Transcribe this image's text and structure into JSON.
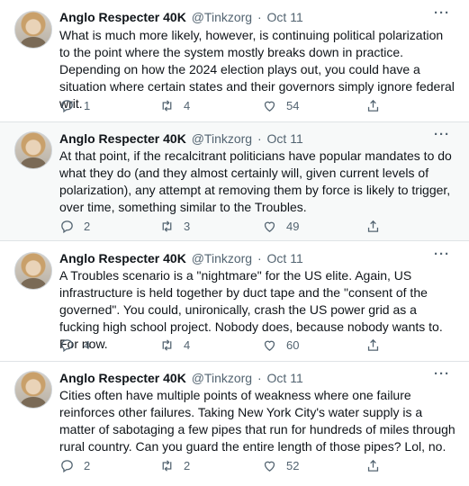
{
  "tweets": [
    {
      "name": "Anglo Respecter 40K",
      "handle": "@Tinkzorg",
      "sep": "·",
      "date": "Oct 11",
      "text": "What is much more likely, however, is continuing political polarization to the point where the system mostly breaks down in practice. Depending on how the 2024 election plays out, you could have a situation where certain states and their governors simply ignore federal writ.",
      "replies": "1",
      "retweets": "4",
      "likes": "54"
    },
    {
      "name": "Anglo Respecter 40K",
      "handle": "@Tinkzorg",
      "sep": "·",
      "date": "Oct 11",
      "text": "At that point, if the recalcitrant politicians have popular mandates to do what they do (and they almost certainly will, given current levels of polarization), any attempt at removing them by force is likely to trigger, over time, something similar to the Troubles.",
      "replies": "2",
      "retweets": "3",
      "likes": "49"
    },
    {
      "name": "Anglo Respecter 40K",
      "handle": "@Tinkzorg",
      "sep": "·",
      "date": "Oct 11",
      "text": "A Troubles scenario is a \"nightmare\" for the US elite. Again, US infrastructure is held together by duct tape and the \"consent of the governed\". You could, unironically, crash the US power grid as a fucking high school project. Nobody does, because nobody wants to. For now.",
      "replies": "4",
      "retweets": "4",
      "likes": "60"
    },
    {
      "name": "Anglo Respecter 40K",
      "handle": "@Tinkzorg",
      "sep": "·",
      "date": "Oct 11",
      "text": "Cities often have multiple points of weakness where one failure reinforces other failures. Taking New York City's water supply is a matter of sabotaging a few pipes that run for hundreds of miles through rural country. Can you guard the entire length of those pipes? Lol, no.",
      "replies": "2",
      "retweets": "2",
      "likes": "52"
    }
  ],
  "icons": {
    "reply": "reply-icon",
    "retweet": "retweet-icon",
    "like": "like-icon",
    "share": "share-icon",
    "more": "more-icon"
  },
  "colors": {
    "text": "#0f1419",
    "secondary": "#536471",
    "highlight_bg": "#f7f9f9",
    "divider": "#dfe3e6"
  }
}
